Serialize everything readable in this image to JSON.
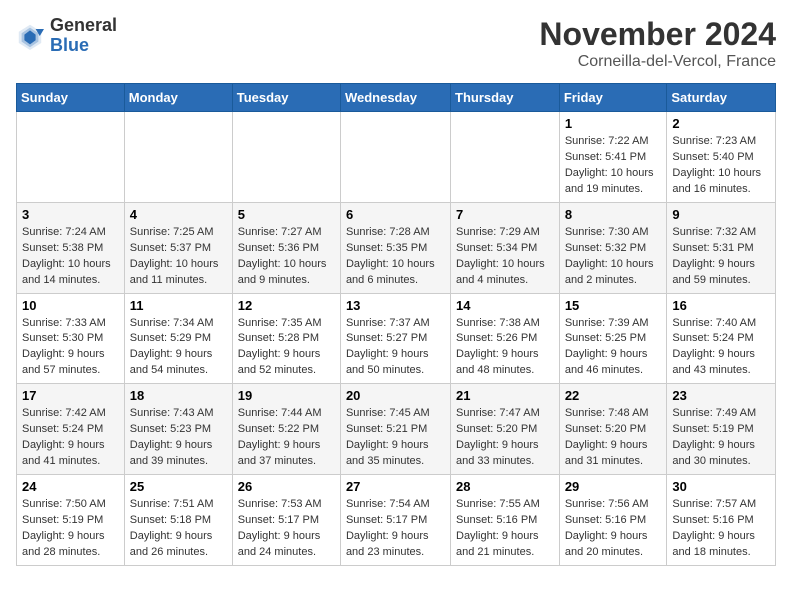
{
  "logo": {
    "general": "General",
    "blue": "Blue"
  },
  "title": "November 2024",
  "location": "Corneilla-del-Vercol, France",
  "days_header": [
    "Sunday",
    "Monday",
    "Tuesday",
    "Wednesday",
    "Thursday",
    "Friday",
    "Saturday"
  ],
  "weeks": [
    [
      {
        "day": "",
        "info": ""
      },
      {
        "day": "",
        "info": ""
      },
      {
        "day": "",
        "info": ""
      },
      {
        "day": "",
        "info": ""
      },
      {
        "day": "",
        "info": ""
      },
      {
        "day": "1",
        "info": "Sunrise: 7:22 AM\nSunset: 5:41 PM\nDaylight: 10 hours and 19 minutes."
      },
      {
        "day": "2",
        "info": "Sunrise: 7:23 AM\nSunset: 5:40 PM\nDaylight: 10 hours and 16 minutes."
      }
    ],
    [
      {
        "day": "3",
        "info": "Sunrise: 7:24 AM\nSunset: 5:38 PM\nDaylight: 10 hours and 14 minutes."
      },
      {
        "day": "4",
        "info": "Sunrise: 7:25 AM\nSunset: 5:37 PM\nDaylight: 10 hours and 11 minutes."
      },
      {
        "day": "5",
        "info": "Sunrise: 7:27 AM\nSunset: 5:36 PM\nDaylight: 10 hours and 9 minutes."
      },
      {
        "day": "6",
        "info": "Sunrise: 7:28 AM\nSunset: 5:35 PM\nDaylight: 10 hours and 6 minutes."
      },
      {
        "day": "7",
        "info": "Sunrise: 7:29 AM\nSunset: 5:34 PM\nDaylight: 10 hours and 4 minutes."
      },
      {
        "day": "8",
        "info": "Sunrise: 7:30 AM\nSunset: 5:32 PM\nDaylight: 10 hours and 2 minutes."
      },
      {
        "day": "9",
        "info": "Sunrise: 7:32 AM\nSunset: 5:31 PM\nDaylight: 9 hours and 59 minutes."
      }
    ],
    [
      {
        "day": "10",
        "info": "Sunrise: 7:33 AM\nSunset: 5:30 PM\nDaylight: 9 hours and 57 minutes."
      },
      {
        "day": "11",
        "info": "Sunrise: 7:34 AM\nSunset: 5:29 PM\nDaylight: 9 hours and 54 minutes."
      },
      {
        "day": "12",
        "info": "Sunrise: 7:35 AM\nSunset: 5:28 PM\nDaylight: 9 hours and 52 minutes."
      },
      {
        "day": "13",
        "info": "Sunrise: 7:37 AM\nSunset: 5:27 PM\nDaylight: 9 hours and 50 minutes."
      },
      {
        "day": "14",
        "info": "Sunrise: 7:38 AM\nSunset: 5:26 PM\nDaylight: 9 hours and 48 minutes."
      },
      {
        "day": "15",
        "info": "Sunrise: 7:39 AM\nSunset: 5:25 PM\nDaylight: 9 hours and 46 minutes."
      },
      {
        "day": "16",
        "info": "Sunrise: 7:40 AM\nSunset: 5:24 PM\nDaylight: 9 hours and 43 minutes."
      }
    ],
    [
      {
        "day": "17",
        "info": "Sunrise: 7:42 AM\nSunset: 5:24 PM\nDaylight: 9 hours and 41 minutes."
      },
      {
        "day": "18",
        "info": "Sunrise: 7:43 AM\nSunset: 5:23 PM\nDaylight: 9 hours and 39 minutes."
      },
      {
        "day": "19",
        "info": "Sunrise: 7:44 AM\nSunset: 5:22 PM\nDaylight: 9 hours and 37 minutes."
      },
      {
        "day": "20",
        "info": "Sunrise: 7:45 AM\nSunset: 5:21 PM\nDaylight: 9 hours and 35 minutes."
      },
      {
        "day": "21",
        "info": "Sunrise: 7:47 AM\nSunset: 5:20 PM\nDaylight: 9 hours and 33 minutes."
      },
      {
        "day": "22",
        "info": "Sunrise: 7:48 AM\nSunset: 5:20 PM\nDaylight: 9 hours and 31 minutes."
      },
      {
        "day": "23",
        "info": "Sunrise: 7:49 AM\nSunset: 5:19 PM\nDaylight: 9 hours and 30 minutes."
      }
    ],
    [
      {
        "day": "24",
        "info": "Sunrise: 7:50 AM\nSunset: 5:19 PM\nDaylight: 9 hours and 28 minutes."
      },
      {
        "day": "25",
        "info": "Sunrise: 7:51 AM\nSunset: 5:18 PM\nDaylight: 9 hours and 26 minutes."
      },
      {
        "day": "26",
        "info": "Sunrise: 7:53 AM\nSunset: 5:17 PM\nDaylight: 9 hours and 24 minutes."
      },
      {
        "day": "27",
        "info": "Sunrise: 7:54 AM\nSunset: 5:17 PM\nDaylight: 9 hours and 23 minutes."
      },
      {
        "day": "28",
        "info": "Sunrise: 7:55 AM\nSunset: 5:16 PM\nDaylight: 9 hours and 21 minutes."
      },
      {
        "day": "29",
        "info": "Sunrise: 7:56 AM\nSunset: 5:16 PM\nDaylight: 9 hours and 20 minutes."
      },
      {
        "day": "30",
        "info": "Sunrise: 7:57 AM\nSunset: 5:16 PM\nDaylight: 9 hours and 18 minutes."
      }
    ]
  ]
}
